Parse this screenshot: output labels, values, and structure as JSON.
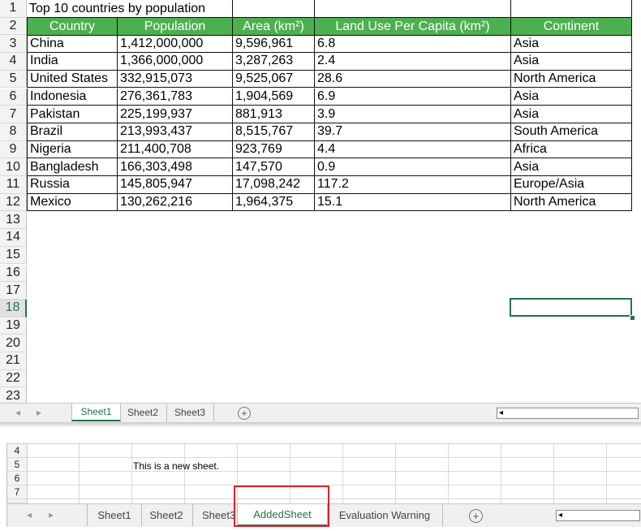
{
  "top_window": {
    "row_numbers": [
      "1",
      "2",
      "3",
      "4",
      "5",
      "6",
      "7",
      "8",
      "9",
      "10",
      "11",
      "12",
      "13",
      "14",
      "15",
      "16",
      "17",
      "18",
      "19",
      "20",
      "21",
      "22",
      "23"
    ],
    "active_row": "18",
    "title": "Top 10 countries by population",
    "headers": [
      "Country",
      "Population",
      "Area (km²)",
      "Land Use Per Capita (km²)",
      "Continent"
    ],
    "rows": [
      [
        "China",
        "1,412,000,000",
        "9,596,961",
        "6.8",
        "Asia"
      ],
      [
        "India",
        "1,366,000,000",
        "3,287,263",
        "2.4",
        "Asia"
      ],
      [
        "United States",
        "332,915,073",
        "9,525,067",
        "28.6",
        "North America"
      ],
      [
        "Indonesia",
        "276,361,783",
        "1,904,569",
        "6.9",
        "Asia"
      ],
      [
        "Pakistan",
        "225,199,937",
        "881,913",
        "3.9",
        "Asia"
      ],
      [
        "Brazil",
        "213,993,437",
        "8,515,767",
        "39.7",
        "South America"
      ],
      [
        "Nigeria",
        "211,400,708",
        "923,769",
        "4.4",
        "Africa"
      ],
      [
        "Bangladesh",
        "166,303,498",
        "147,570",
        "0.9",
        "Asia"
      ],
      [
        "Russia",
        "145,805,947",
        "17,098,242",
        "117.2",
        "Europe/Asia"
      ],
      [
        "Mexico",
        "130,262,216",
        "1,964,375",
        "15.1",
        "North America"
      ]
    ],
    "tabs": [
      "Sheet1",
      "Sheet2",
      "Sheet3"
    ],
    "active_tab": "Sheet1",
    "header_color": "#4caf50"
  },
  "bottom_window": {
    "row_numbers": [
      "4",
      "5",
      "6",
      "7"
    ],
    "cell_text": "This is a new sheet.",
    "tabs": [
      "Sheet1",
      "Sheet2",
      "Sheet3",
      "AddedSheet",
      "Evaluation Warning"
    ],
    "active_tab": "AddedSheet",
    "highlight_color": "#e3202c"
  },
  "icons": {
    "nav_left": "◂",
    "nav_right": "▸",
    "add_sheet": "+",
    "scroll_left": "◂"
  },
  "accent_color": "#217346"
}
